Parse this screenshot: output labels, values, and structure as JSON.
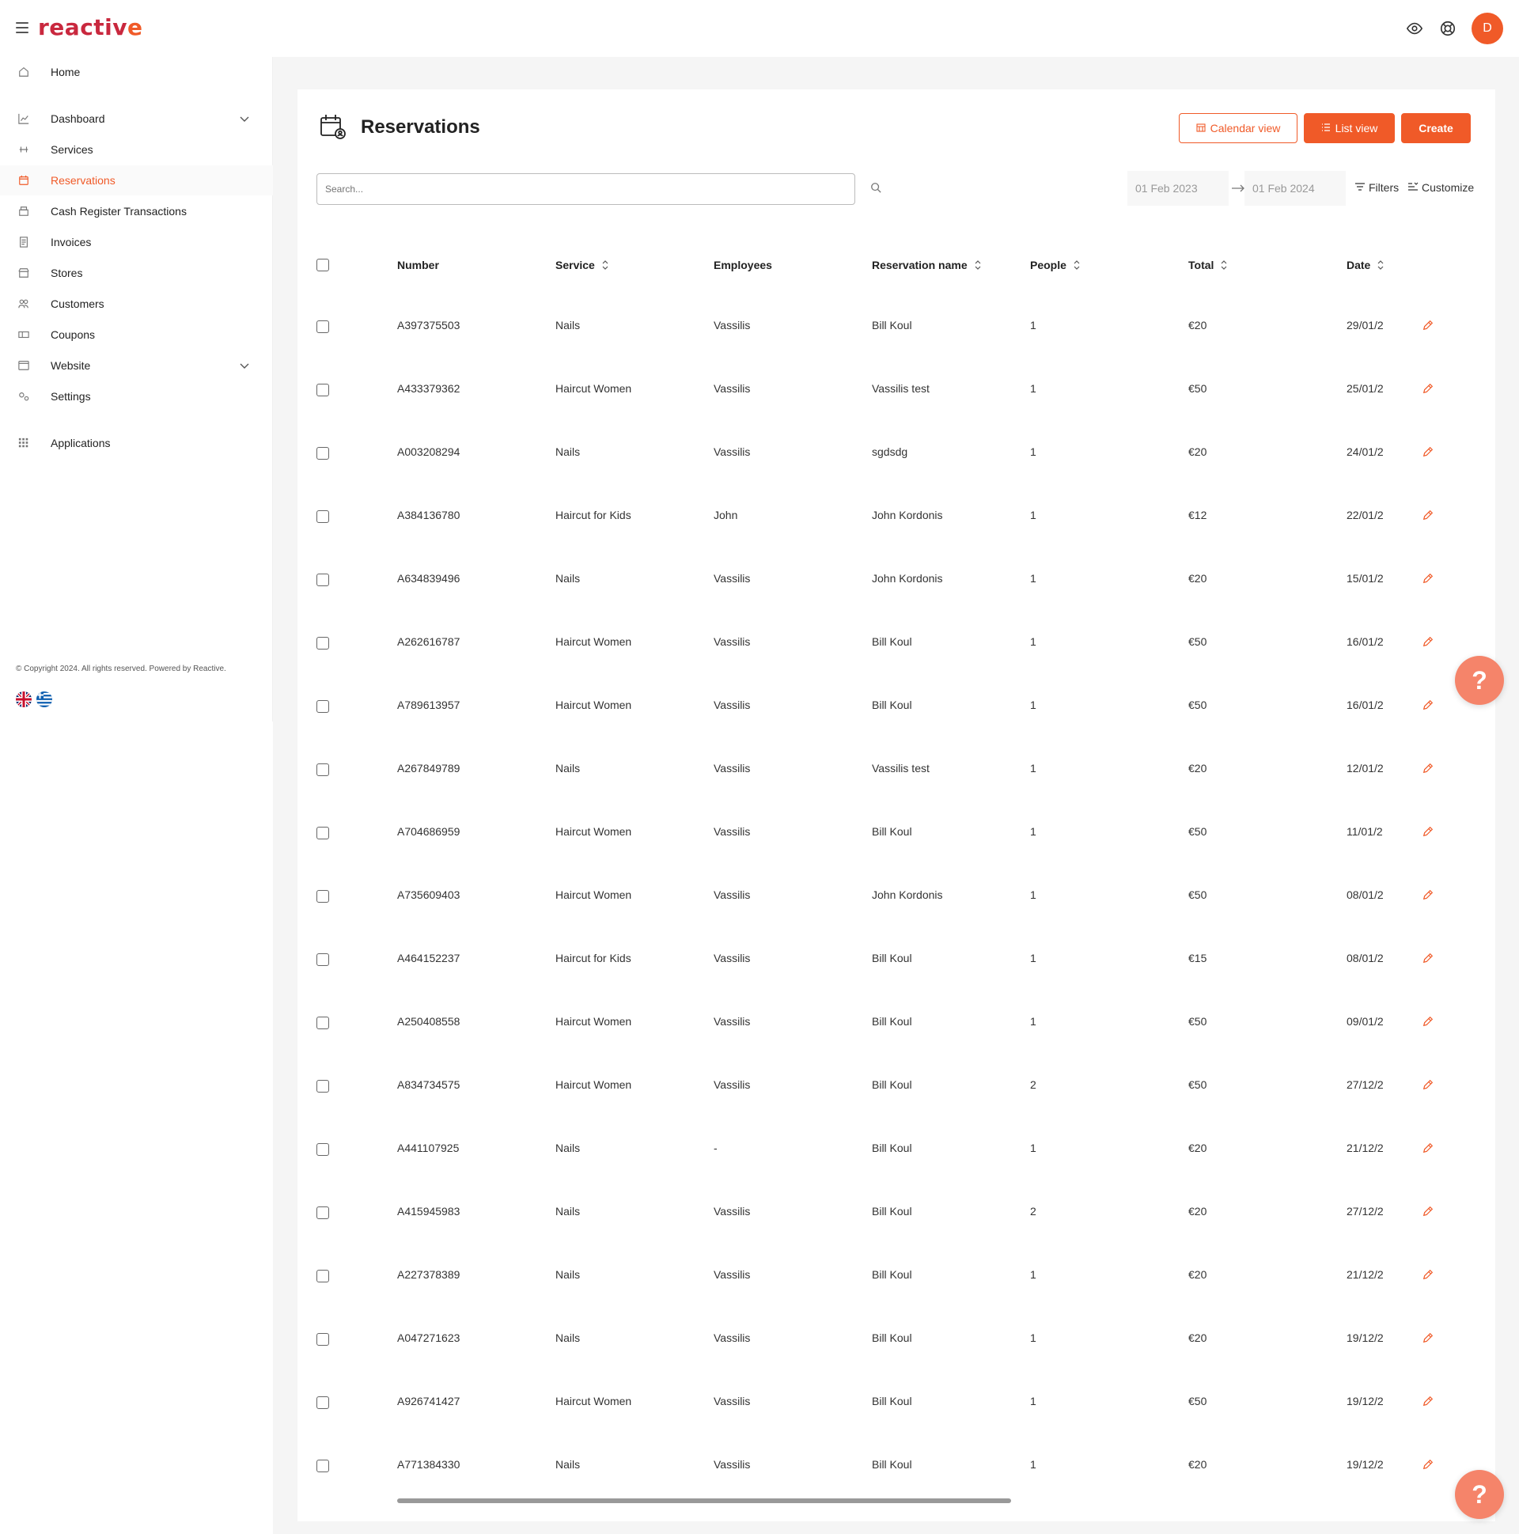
{
  "brand": {
    "logo_text": "reactiv",
    "logo_tail": "e",
    "accent": "#f05a28"
  },
  "header": {
    "avatar_letter": "D"
  },
  "sidebar": {
    "items": [
      {
        "label": "Home",
        "icon": "home-icon"
      },
      {
        "label": "Dashboard",
        "icon": "chart-line-icon",
        "expandable": true
      },
      {
        "label": "Services",
        "icon": "services-icon"
      },
      {
        "label": "Reservations",
        "icon": "calendar-icon",
        "active": true
      },
      {
        "label": "Cash Register Transactions",
        "icon": "cash-register-icon"
      },
      {
        "label": "Invoices",
        "icon": "invoice-icon"
      },
      {
        "label": "Stores",
        "icon": "store-icon"
      },
      {
        "label": "Customers",
        "icon": "customers-icon"
      },
      {
        "label": "Coupons",
        "icon": "coupon-icon"
      },
      {
        "label": "Website",
        "icon": "website-icon",
        "expandable": true
      },
      {
        "label": "Settings",
        "icon": "settings-icon"
      },
      {
        "label": "Applications",
        "icon": "apps-grid-icon"
      }
    ],
    "copyright": "© Copyright 2024. All rights reserved. Powered by Reactive."
  },
  "page": {
    "title": "Reservations",
    "buttons": {
      "calendar_view": "Calendar view",
      "list_view": "List view",
      "create": "Create"
    },
    "search": {
      "placeholder": "Search..."
    },
    "date_from": "01 Feb 2023",
    "date_to": "01 Feb 2024",
    "filters_label": "Filters",
    "customize_label": "Customize"
  },
  "table": {
    "columns": [
      "Number",
      "Service",
      "Employees",
      "Reservation name",
      "People",
      "Total",
      "Date"
    ],
    "rows": [
      {
        "number": "A397375503",
        "service": "Nails",
        "employee": "Vassilis",
        "name": "Bill Koul",
        "people": "1",
        "total": "€20",
        "date": "29/01/2"
      },
      {
        "number": "A433379362",
        "service": "Haircut Women",
        "employee": "Vassilis",
        "name": "Vassilis test",
        "people": "1",
        "total": "€50",
        "date": "25/01/2"
      },
      {
        "number": "A003208294",
        "service": "Nails",
        "employee": "Vassilis",
        "name": "sgdsdg",
        "people": "1",
        "total": "€20",
        "date": "24/01/2"
      },
      {
        "number": "A384136780",
        "service": "Haircut for Kids",
        "employee": "John",
        "name": "John Kordonis",
        "people": "1",
        "total": "€12",
        "date": "22/01/2"
      },
      {
        "number": "A634839496",
        "service": "Nails",
        "employee": "Vassilis",
        "name": "John Kordonis",
        "people": "1",
        "total": "€20",
        "date": "15/01/2"
      },
      {
        "number": "A262616787",
        "service": "Haircut Women",
        "employee": "Vassilis",
        "name": "Bill Koul",
        "people": "1",
        "total": "€50",
        "date": "16/01/2"
      },
      {
        "number": "A789613957",
        "service": "Haircut Women",
        "employee": "Vassilis",
        "name": "Bill Koul",
        "people": "1",
        "total": "€50",
        "date": "16/01/2"
      },
      {
        "number": "A267849789",
        "service": "Nails",
        "employee": "Vassilis",
        "name": "Vassilis test",
        "people": "1",
        "total": "€20",
        "date": "12/01/2"
      },
      {
        "number": "A704686959",
        "service": "Haircut Women",
        "employee": "Vassilis",
        "name": "Bill Koul",
        "people": "1",
        "total": "€50",
        "date": "11/01/2"
      },
      {
        "number": "A735609403",
        "service": "Haircut Women",
        "employee": "Vassilis",
        "name": "John Kordonis",
        "people": "1",
        "total": "€50",
        "date": "08/01/2"
      },
      {
        "number": "A464152237",
        "service": "Haircut for Kids",
        "employee": "Vassilis",
        "name": "Bill Koul",
        "people": "1",
        "total": "€15",
        "date": "08/01/2"
      },
      {
        "number": "A250408558",
        "service": "Haircut Women",
        "employee": "Vassilis",
        "name": "Bill Koul",
        "people": "1",
        "total": "€50",
        "date": "09/01/2"
      },
      {
        "number": "A834734575",
        "service": "Haircut Women",
        "employee": "Vassilis",
        "name": "Bill Koul",
        "people": "2",
        "total": "€50",
        "date": "27/12/2"
      },
      {
        "number": "A441107925",
        "service": "Nails",
        "employee": "-",
        "name": "Bill Koul",
        "people": "1",
        "total": "€20",
        "date": "21/12/2"
      },
      {
        "number": "A415945983",
        "service": "Nails",
        "employee": "Vassilis",
        "name": "Bill Koul",
        "people": "2",
        "total": "€20",
        "date": "27/12/2"
      },
      {
        "number": "A227378389",
        "service": "Nails",
        "employee": "Vassilis",
        "name": "Bill Koul",
        "people": "1",
        "total": "€20",
        "date": "21/12/2"
      },
      {
        "number": "A047271623",
        "service": "Nails",
        "employee": "Vassilis",
        "name": "Bill Koul",
        "people": "1",
        "total": "€20",
        "date": "19/12/2"
      },
      {
        "number": "A926741427",
        "service": "Haircut Women",
        "employee": "Vassilis",
        "name": "Bill Koul",
        "people": "1",
        "total": "€50",
        "date": "19/12/2"
      },
      {
        "number": "A771384330",
        "service": "Nails",
        "employee": "Vassilis",
        "name": "Bill Koul",
        "people": "1",
        "total": "€20",
        "date": "19/12/2"
      }
    ]
  },
  "help": {
    "label": "?"
  }
}
